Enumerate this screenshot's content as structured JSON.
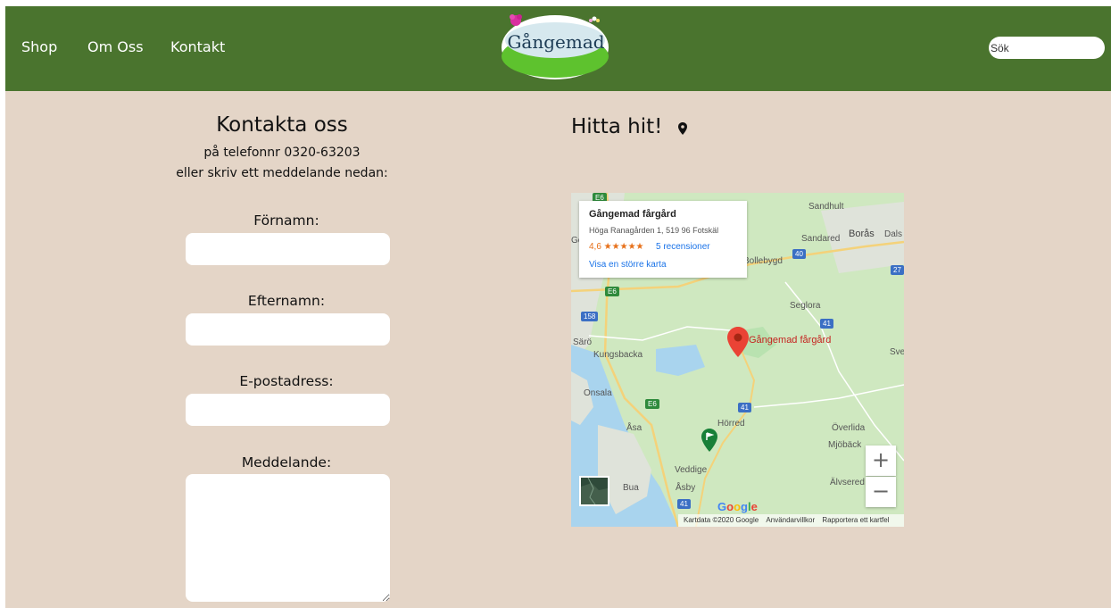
{
  "header": {
    "nav": [
      "Shop",
      "Om Oss",
      "Kontakt"
    ],
    "logo_text": "Gångemad",
    "search_placeholder": "Sök",
    "bg_color": "#4a742e"
  },
  "contact": {
    "title": "Kontakta oss",
    "phone_line": "på telefonnr 0320-63203",
    "message_line": "eller skriv ett meddelande nedan:",
    "fields": {
      "firstname": "Förnamn:",
      "lastname": "Efternamn:",
      "email": "E-postadress:",
      "message": "Meddelande:"
    }
  },
  "map": {
    "title": "Hitta hit!",
    "info_name": "Gångemad fårgård",
    "info_address": "Höga Ranagården 1, 519 96 Fotskäl",
    "info_rating": "4,6 ★★★★★",
    "info_reviews": "5 recensioner",
    "info_larger_map": "Visa en större karta",
    "pin_label": "Gångemad fårgård",
    "places": [
      "Sandhult",
      "Sandared",
      "Borås",
      "Dals",
      "Bollebygd",
      "Seglora",
      "Särö",
      "Kungsbacka",
      "Sve",
      "Onsala",
      "Åsa",
      "Hörred",
      "Överlida",
      "Mjöbäck",
      "Veddige",
      "Älvsered",
      "Bua",
      "Åsby",
      "Gö"
    ],
    "roads": [
      "E6",
      "40",
      "27",
      "E6",
      "158",
      "41",
      "E6",
      "41",
      "41"
    ],
    "footer": [
      "Kartdata ©2020 Google",
      "Användarvillkor",
      "Rapportera ett kartfel"
    ],
    "google": "Google",
    "zoom_in": "+",
    "zoom_out": "−"
  },
  "colors": {
    "page_bg": "#e4d5c7",
    "accent_green": "#4a742e"
  }
}
